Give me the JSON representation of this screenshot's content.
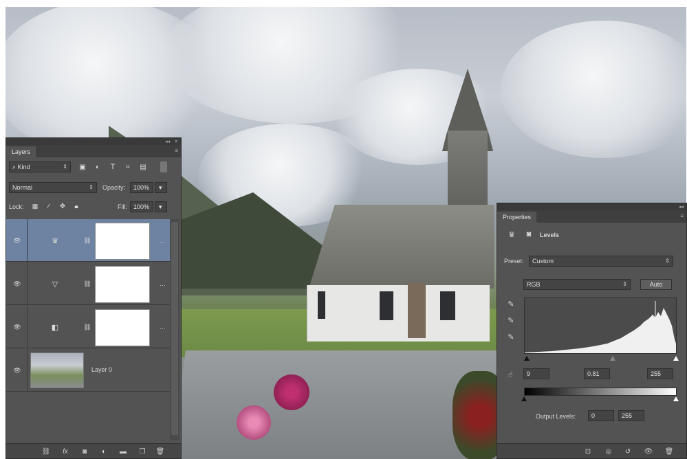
{
  "layers_panel": {
    "tab": "Layers",
    "filter_kind": "Kind",
    "blend_mode": "Normal",
    "opacity_label": "Opacity:",
    "opacity_value": "100%",
    "lock_label": "Lock:",
    "fill_label": "Fill:",
    "fill_value": "100%",
    "layers": [
      {
        "type": "levels-adjustment",
        "icon": "levels-icon",
        "selected": true
      },
      {
        "type": "vibrance-adjustment",
        "icon": "vibrance-triangle-icon",
        "selected": false
      },
      {
        "type": "brightness-contrast-adjustment",
        "icon": "brightness-contrast-icon",
        "selected": false
      },
      {
        "type": "pixel-layer",
        "name": "Layer 0",
        "selected": false
      }
    ],
    "footer_icons": [
      "link-icon",
      "fx-icon",
      "mask-icon",
      "adjustment-icon",
      "folder-icon",
      "new-layer-icon",
      "trash-icon"
    ]
  },
  "properties_panel": {
    "tab": "Properties",
    "title": "Levels",
    "preset_label": "Preset:",
    "preset_value": "Custom",
    "channel_value": "RGB",
    "auto_button": "Auto",
    "input_black": "9",
    "input_gamma": "0.81",
    "input_white": "255",
    "output_label": "Output Levels:",
    "output_black": "0",
    "output_white": "255",
    "footer_icons": [
      "clip-to-layer-icon",
      "view-previous-icon",
      "reset-icon",
      "visibility-eye-icon",
      "trash-icon"
    ]
  },
  "colors": {
    "panel_bg": "#535353",
    "selected_row": "#6d83a1"
  }
}
